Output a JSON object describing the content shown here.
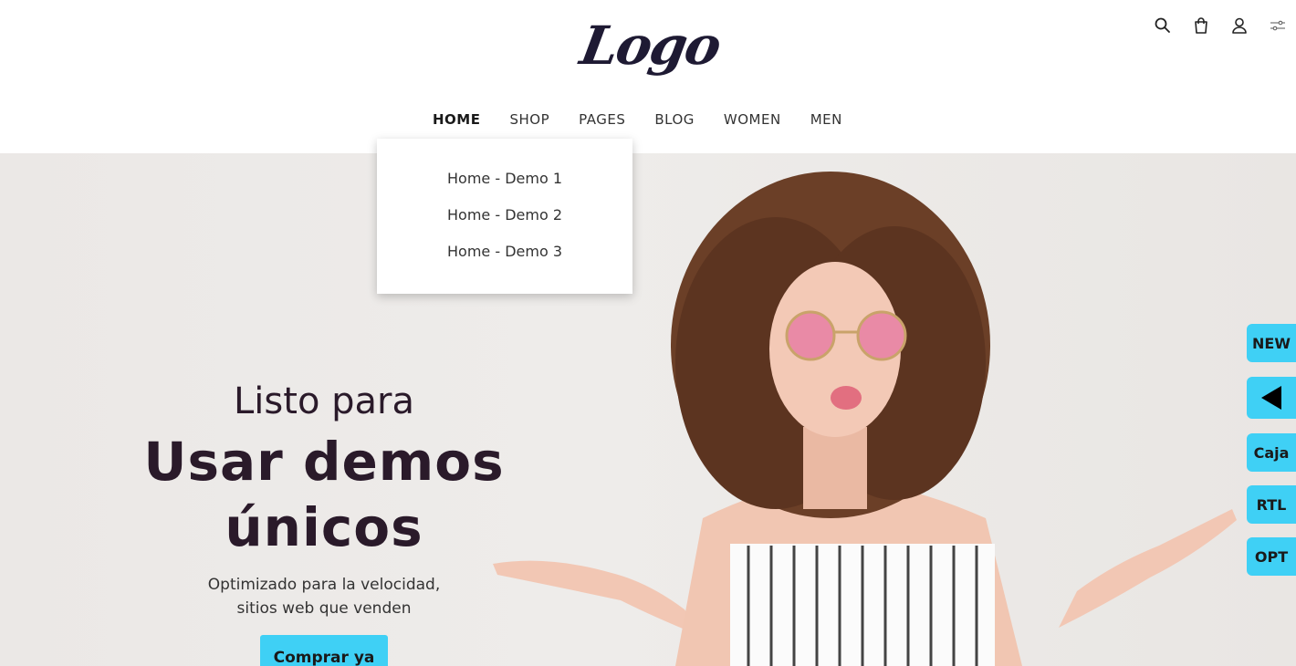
{
  "header": {
    "logo_text": "Logo",
    "icons": [
      "search-icon",
      "bag-icon",
      "user-icon",
      "settings-icon"
    ]
  },
  "nav": {
    "items": [
      {
        "label": "HOME",
        "active": true
      },
      {
        "label": "SHOP"
      },
      {
        "label": "PAGES"
      },
      {
        "label": "BLOG"
      },
      {
        "label": "WOMEN"
      },
      {
        "label": "MEN"
      }
    ],
    "dropdown": [
      "Home - Demo 1",
      "Home - Demo 2",
      "Home - Demo 3"
    ]
  },
  "hero": {
    "line1": "Listo para",
    "line2": "Usar demos",
    "line3": "únicos",
    "sub1": "Optimizado para la velocidad,",
    "sub2": "sitios web que venden",
    "button": "Comprar ya"
  },
  "side": {
    "new": "NEW",
    "box": "Caja",
    "rtl": "RTL",
    "opt": "OPT"
  },
  "colors": {
    "accent": "#3fd0f5",
    "text_dark": "#2a1a2a",
    "logo": "#1e1a33"
  }
}
